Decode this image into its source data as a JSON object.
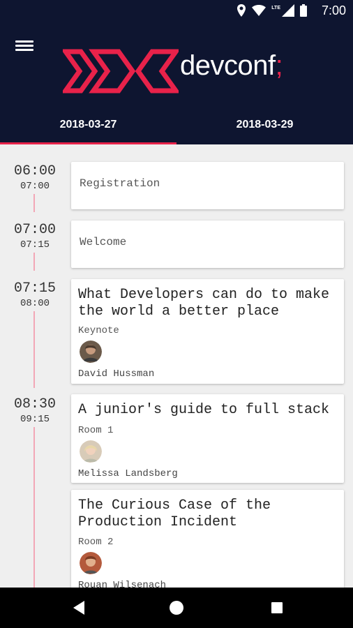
{
  "status_bar": {
    "time": "7:00",
    "network": "LTE"
  },
  "header": {
    "menu_icon": "hamburger-menu-icon",
    "logo_text": "devconf",
    "logo_suffix": ";",
    "accent_color": "#e8224a",
    "background_color": "#0e1530"
  },
  "tabs": [
    {
      "label": "2018-03-27",
      "active": true
    },
    {
      "label": "2018-03-29",
      "active": false
    }
  ],
  "schedule": [
    {
      "start": "06:00",
      "end": "07:00"
    },
    {
      "start": "07:00",
      "end": "07:15"
    },
    {
      "start": "07:15",
      "end": "08:00"
    },
    {
      "start": "08:30",
      "end": "09:15"
    }
  ],
  "sessions": [
    {
      "title": "Registration"
    },
    {
      "title": "Welcome"
    },
    {
      "title": "What Developers can do to make the world a better place",
      "room": "Keynote",
      "speaker": "David Hussman"
    },
    {
      "title": "A junior's guide to full stack",
      "room": "Room 1",
      "speaker": "Melissa Landsberg"
    },
    {
      "title": "The Curious Case of the Production Incident",
      "room": "Room 2",
      "speaker": "Rouan Wilsenach"
    }
  ],
  "nav_bar": {
    "back_icon": "back-triangle-icon",
    "home_icon": "home-circle-icon",
    "recents_icon": "recents-square-icon"
  }
}
